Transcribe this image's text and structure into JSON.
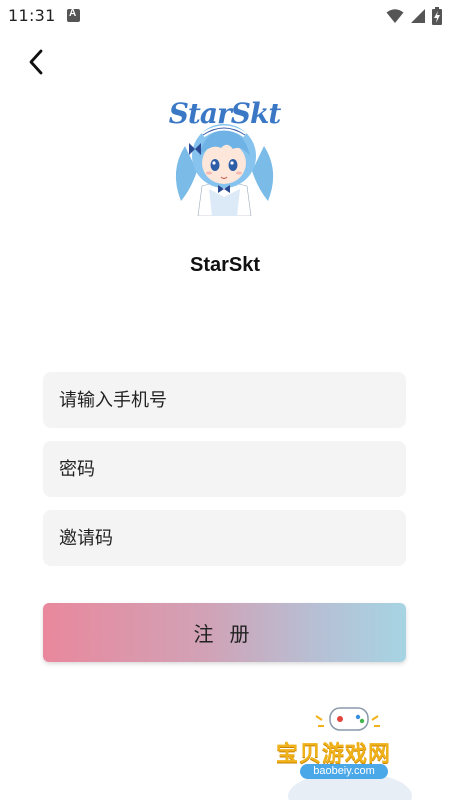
{
  "status_bar": {
    "time": "11:31",
    "icons": [
      "notification-a-icon",
      "wifi-icon",
      "cellular-signal-icon",
      "battery-charging-icon"
    ]
  },
  "navigation": {
    "back_icon": "chevron-left-icon"
  },
  "app": {
    "logo_text": "StarSkt",
    "name": "StarSkt"
  },
  "form": {
    "phone_placeholder": "请输入手机号",
    "password_placeholder": "密码",
    "invite_placeholder": "邀请码",
    "register_label": "注册"
  },
  "watermark": {
    "title": "宝贝游戏网",
    "url": "baobeiy.com"
  },
  "colors": {
    "button_gradient_start": "#e9889d",
    "button_gradient_end": "#a6d4e3",
    "field_background": "#f4f4f5",
    "logo_text": "#3a78c6"
  }
}
